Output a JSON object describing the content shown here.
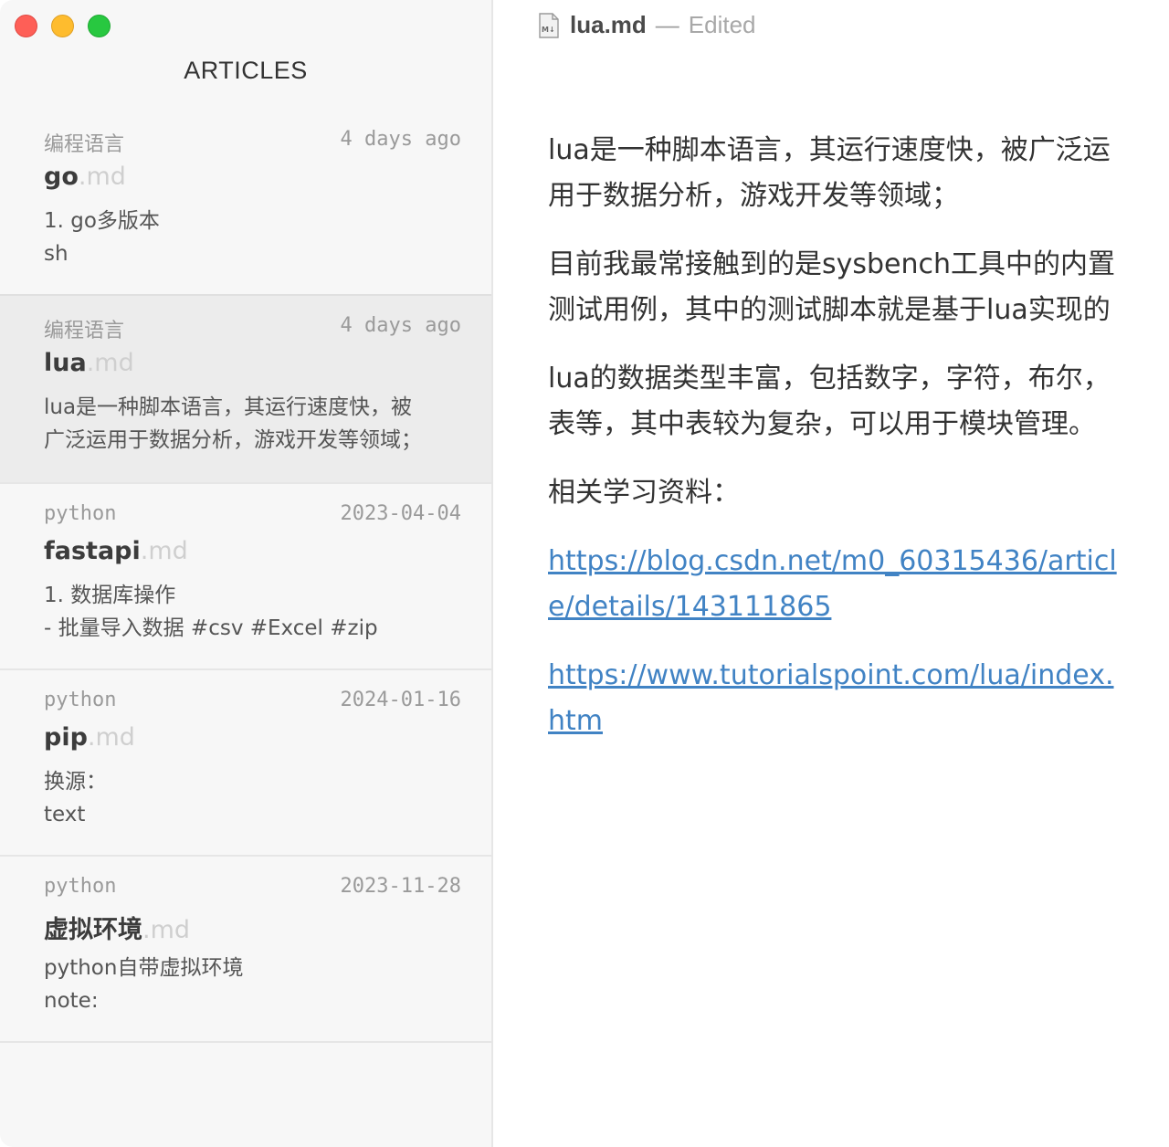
{
  "sidebar": {
    "title": "ARTICLES",
    "articles": [
      {
        "category": "编程语言",
        "date": "4 days ago",
        "name": "go",
        "ext": ".md",
        "preview": [
          "1. go多版本",
          "sh"
        ]
      },
      {
        "category": "编程语言",
        "date": "4 days ago",
        "name": "lua",
        "ext": ".md",
        "preview": [
          "lua是一种脚本语言，其运行速度快，被",
          "广泛运用于数据分析，游戏开发等领域；"
        ]
      },
      {
        "category": "python",
        "date": "2023-04-04",
        "name": "fastapi",
        "ext": ".md",
        "preview": [
          "1. 数据库操作",
          "- 批量导入数据 #csv #Excel #zip"
        ]
      },
      {
        "category": "python",
        "date": "2024-01-16",
        "name": "pip",
        "ext": ".md",
        "preview": [
          "换源：",
          "text"
        ]
      },
      {
        "category": "python",
        "date": "2023-11-28",
        "name": "虚拟环境",
        "ext": ".md",
        "preview": [
          "python自带虚拟环境",
          "note:"
        ]
      }
    ]
  },
  "editor": {
    "file_name": "lua.md",
    "separator": "—",
    "status": "Edited",
    "file_icon": "markdown-file-icon",
    "paragraphs": [
      "lua是一种脚本语言，其运行速度快，被广泛运用于数据分析，游戏开发等领域；",
      "目前我最常接触到的是sysbench工具中的内置测试用例，其中的测试脚本就是基于lua实现的",
      "lua的数据类型丰富，包括数字，字符，布尔，表等，其中表较为复杂，可以用于模块管理。",
      "相关学习资料："
    ],
    "links": [
      "https://blog.csdn.net/m0_60315436/article/details/143111865",
      "https://www.tutorialspoint.com/lua/index.htm"
    ],
    "link_color": "#4183c4"
  }
}
